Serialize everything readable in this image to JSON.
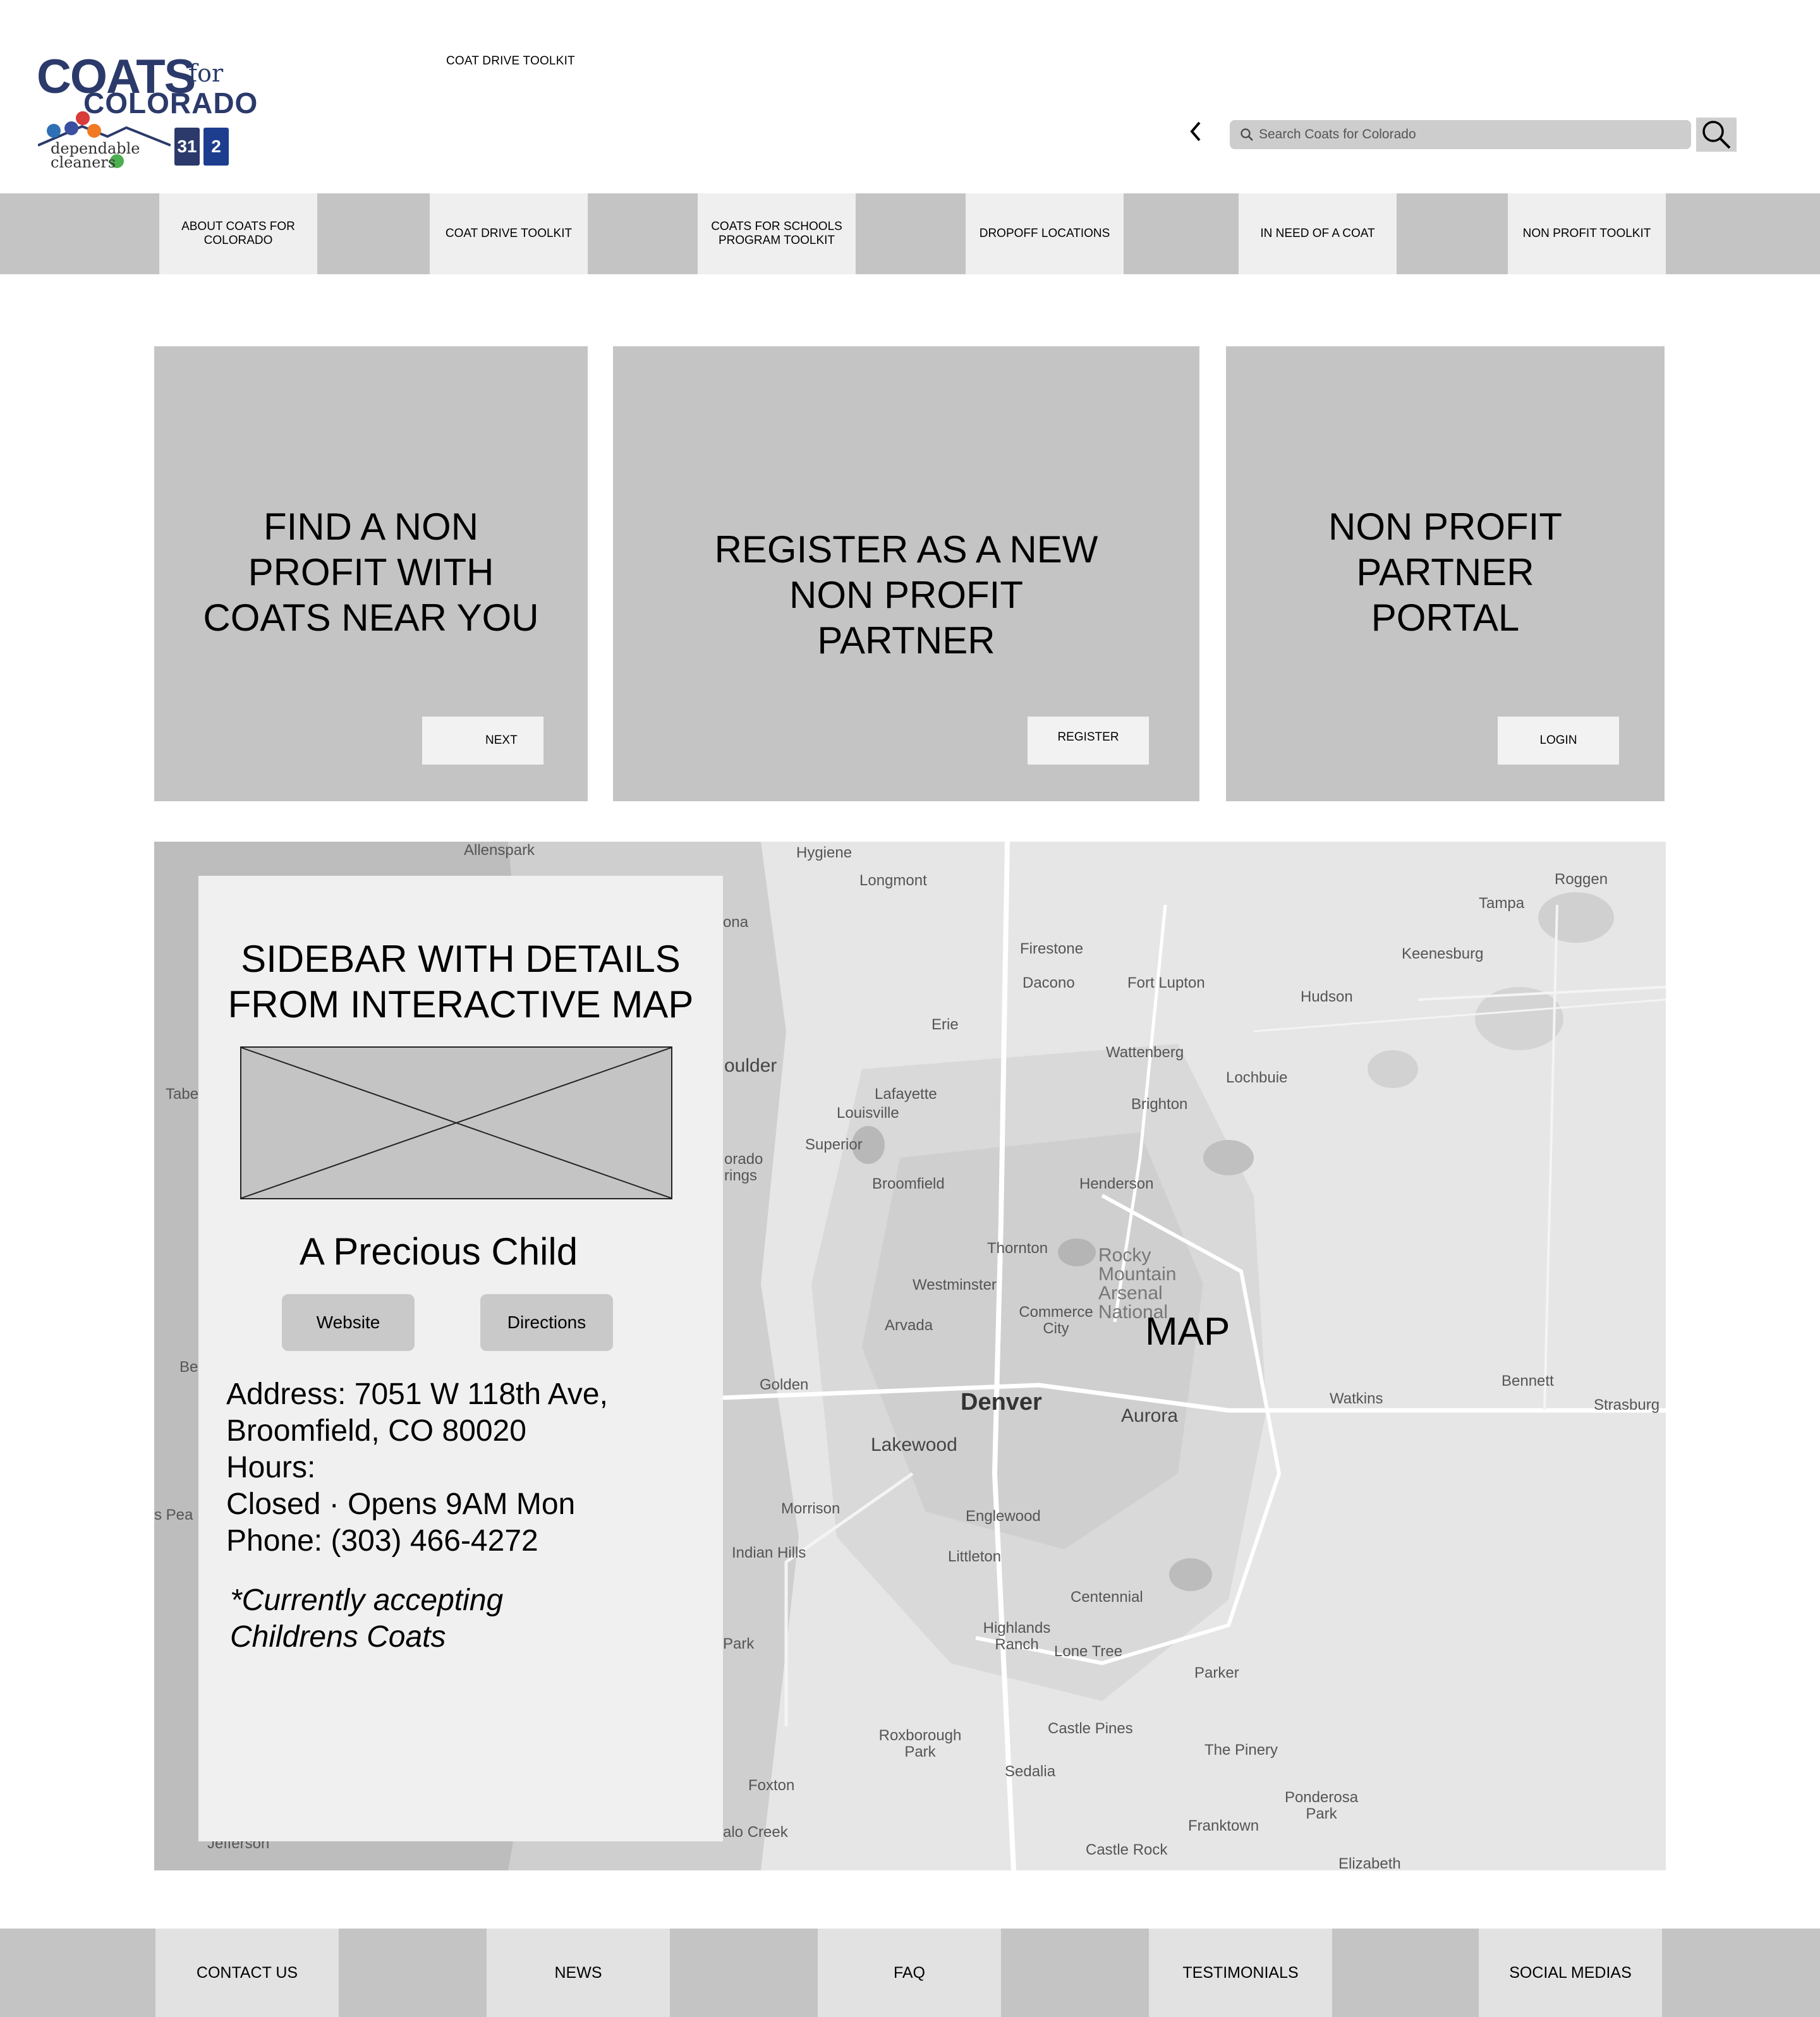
{
  "header": {
    "page_title": "COAT DRIVE TOOLKIT",
    "logo": {
      "coats": "COATS",
      "for": "for",
      "colorado": "COLORADO",
      "sponsor": "dependable cleaners",
      "tv_left": "31",
      "tv_right": "2"
    },
    "search": {
      "placeholder": "Search Coats for Colorado",
      "value": ""
    }
  },
  "nav": {
    "items": [
      {
        "label": "ABOUT COATS FOR COLORADO"
      },
      {
        "label": "COAT DRIVE TOOLKIT"
      },
      {
        "label": "COATS FOR SCHOOLS PROGRAM TOOLKIT"
      },
      {
        "label": "DROPOFF LOCATIONS"
      },
      {
        "label": "IN NEED OF A COAT"
      },
      {
        "label": "NON PROFIT TOOLKIT"
      }
    ]
  },
  "cards": [
    {
      "title": "FIND A NON PROFIT WITH COATS NEAR YOU",
      "button": "NEXT"
    },
    {
      "title": "REGISTER AS A NEW NON PROFIT PARTNER",
      "button": "REGISTER"
    },
    {
      "title": "NON PROFIT PARTNER PORTAL",
      "button": "LOGIN"
    }
  ],
  "map": {
    "placeholder_label": "MAP",
    "places": {
      "denver": "Denver",
      "aurora": "Aurora",
      "lakewood": "Lakewood",
      "boulder": "oulder",
      "longmont": "Longmont",
      "hygiene": "Hygiene",
      "allenspark": "Allenspark",
      "firestone": "Firestone",
      "dacono": "Dacono",
      "fort_lupton": "Fort Lupton",
      "erie": "Erie",
      "wattenberg": "Wattenberg",
      "brighton": "Brighton",
      "lafayette": "Lafayette",
      "louisville": "Louisville",
      "superior": "Superior",
      "broomfield": "Broomfield",
      "henderson": "Henderson",
      "thornton": "Thornton",
      "westminster": "Westminster",
      "arvada": "Arvada",
      "commerce_city": "Commerce City",
      "rocky_mountain": "Rocky Mountain Arsenal National",
      "golden": "Golden",
      "morrison": "Morrison",
      "englewood": "Englewood",
      "littleton": "Littleton",
      "centennial": "Centennial",
      "indian_hills": "Indian Hills",
      "highlands_ranch": "Highlands Ranch",
      "lone_tree": "Lone Tree",
      "parker": "Parker",
      "castle_pines": "Castle Pines",
      "roxborough_park": "Roxborough Park",
      "sedalia": "Sedalia",
      "the_pinery": "The Pinery",
      "ponderosa_park": "Ponderosa Park",
      "franktown": "Franktown",
      "castle_rock": "Castle Rock",
      "elizabeth": "Elizabeth",
      "foxton": "Foxton",
      "jefferson": "Jefferson",
      "buffalo_creek": "alo Creek",
      "tampa": "Tampa",
      "roggen": "Roggen",
      "keenesburg": "Keenesburg",
      "hudson": "Hudson",
      "lochbuie": "Lochbuie",
      "watkins": "Watkins",
      "bennett": "Bennett",
      "strasburg": "Strasburg",
      "tabe": "Tabe",
      "lona": "ona",
      "park": "Park",
      "pea": "s Pea",
      "be": "Be",
      "colorado_springs": "orado\nrings"
    },
    "sidebar": {
      "title": "SIDEBAR WITH DETAILS FROM INTERACTIVE MAP",
      "org_name": "A Precious Child",
      "website_button": "Website",
      "directions_button": "Directions",
      "address": "Address: 7051 W 118th Ave,\nBroomfield, CO 80020",
      "hours": "Hours:\nClosed · Opens 9AM Mon",
      "phone": "Phone: (303) 466-4272",
      "note": "*Currently accepting\nChildrens Coats"
    }
  },
  "footer": {
    "items": [
      {
        "label": "CONTACT US"
      },
      {
        "label": "NEWS"
      },
      {
        "label": "FAQ"
      },
      {
        "label": "TESTIMONIALS"
      },
      {
        "label": "SOCIAL MEDIAS"
      }
    ]
  },
  "colors": {
    "nav_bg": "#c4c4c4",
    "nav_item_bg": "#efefef",
    "card_bg": "#c4c4c4",
    "sidebar_bg": "#f0f0f0",
    "brand_navy": "#2b3a6b"
  },
  "icons": [
    "search-icon",
    "back-chevron-icon",
    "image-placeholder-icon"
  ]
}
